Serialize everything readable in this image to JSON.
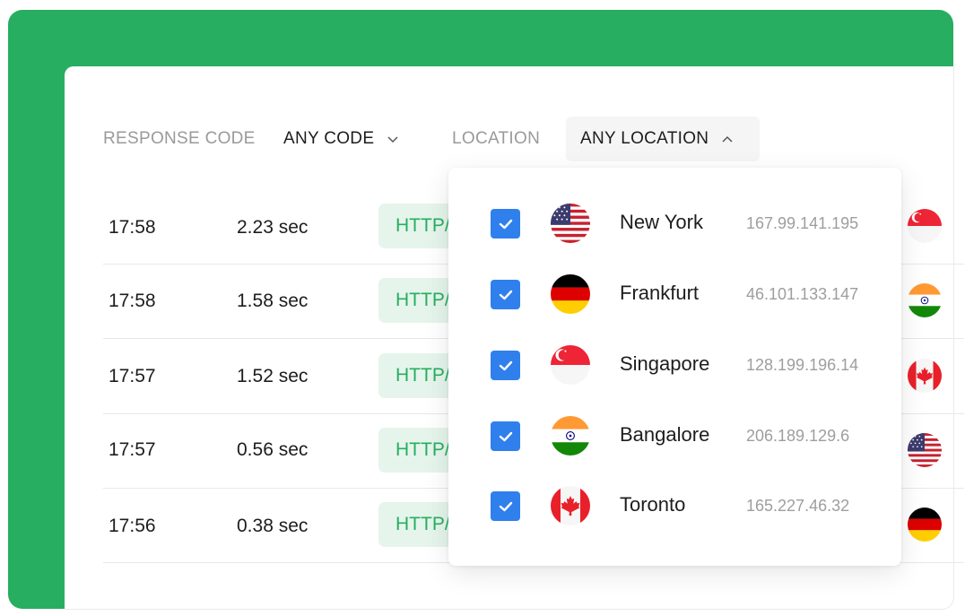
{
  "colors": {
    "brand_green": "#27ae60",
    "badge_bg": "#e5f5ec",
    "checkbox_blue": "#2f80ed"
  },
  "filters": {
    "response_code": {
      "label": "RESPONSE CODE",
      "value": "ANY CODE",
      "icon": "chevron-down-icon",
      "expanded": false
    },
    "location": {
      "label": "LOCATION",
      "value": "ANY LOCATION",
      "icon": "chevron-up-icon",
      "expanded": true
    }
  },
  "rows": [
    {
      "time": "17:58",
      "duration": "2.23 sec",
      "status": "HTTP/",
      "flag": "singapore-flag-icon"
    },
    {
      "time": "17:58",
      "duration": "1.58 sec",
      "status": "HTTP/",
      "flag": "india-flag-icon"
    },
    {
      "time": "17:57",
      "duration": "1.52 sec",
      "status": "HTTP/",
      "flag": "canada-flag-icon"
    },
    {
      "time": "17:57",
      "duration": "0.56 sec",
      "status": "HTTP/",
      "flag": "usa-flag-icon"
    },
    {
      "time": "17:56",
      "duration": "0.38 sec",
      "status": "HTTP/",
      "flag": "germany-flag-icon"
    }
  ],
  "location_dropdown": {
    "options": [
      {
        "city": "New York",
        "ip": "167.99.141.195",
        "checked": true,
        "flag": "usa-flag-icon"
      },
      {
        "city": "Frankfurt",
        "ip": "46.101.133.147",
        "checked": true,
        "flag": "germany-flag-icon"
      },
      {
        "city": "Singapore",
        "ip": "128.199.196.14",
        "checked": true,
        "flag": "singapore-flag-icon"
      },
      {
        "city": "Bangalore",
        "ip": "206.189.129.6",
        "checked": true,
        "flag": "india-flag-icon"
      },
      {
        "city": "Toronto",
        "ip": "165.227.46.32",
        "checked": true,
        "flag": "canada-flag-icon"
      }
    ]
  }
}
